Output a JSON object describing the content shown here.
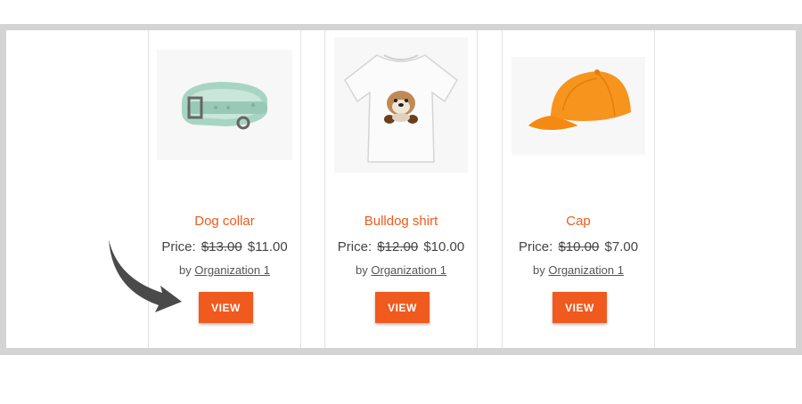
{
  "products": [
    {
      "name": "Dog collar",
      "price_label": "Price:",
      "old_price": "$13.00",
      "new_price": "$11.00",
      "by_label": "by",
      "organization": "Organization 1",
      "view_label": "VIEW",
      "image_icon": "dog-collar-image"
    },
    {
      "name": "Bulldog shirt",
      "price_label": "Price:",
      "old_price": "$12.00",
      "new_price": "$10.00",
      "by_label": "by",
      "organization": "Organization 1",
      "view_label": "VIEW",
      "image_icon": "bulldog-shirt-image"
    },
    {
      "name": "Cap",
      "price_label": "Price:",
      "old_price": "$10.00",
      "new_price": "$7.00",
      "by_label": "by",
      "organization": "Organization 1",
      "view_label": "VIEW",
      "image_icon": "cap-image"
    }
  ],
  "colors": {
    "accent": "#f05a1e",
    "frame": "#d4d4d4",
    "collar": "#9fd1bd",
    "cap": "#f7941d",
    "arrow": "#4a4a4a"
  },
  "annotation": {
    "icon": "curved-arrow-icon"
  }
}
